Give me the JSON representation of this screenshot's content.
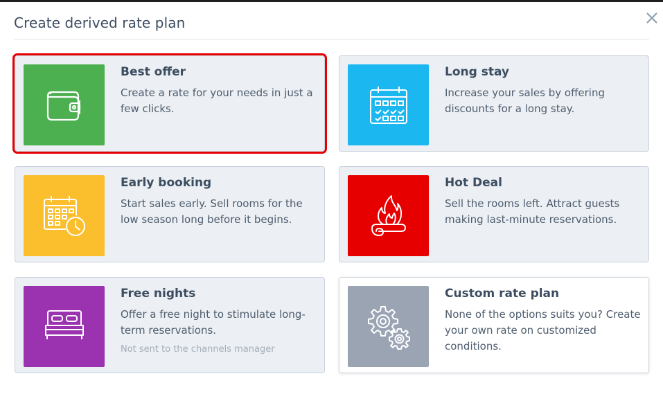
{
  "dialog": {
    "title": "Create derived rate plan"
  },
  "cards": [
    {
      "title": "Best offer",
      "desc": "Create a rate for your needs in just a few clicks.",
      "color": "#4caf50",
      "icon": "wallet-icon",
      "selected": true
    },
    {
      "title": "Long stay",
      "desc": "Increase your sales by offering discounts for a long stay.",
      "color": "#1ab7f0",
      "icon": "calendar-icon"
    },
    {
      "title": "Early booking",
      "desc": "Start sales early. Sell rooms for the low season long before it begins.",
      "color": "#fbbf2e",
      "icon": "calendar-clock-icon"
    },
    {
      "title": "Hot Deal",
      "desc": "Sell the rooms left. Attract guests making last-minute reservations.",
      "color": "#e60000",
      "icon": "flame-icon"
    },
    {
      "title": "Free nights",
      "desc": "Offer a free night to stimulate long-term reservations.",
      "note": "Not sent to the channels manager",
      "color": "#9b32b0",
      "icon": "bed-icon"
    },
    {
      "title": "Custom rate plan",
      "desc": "None of the options suits you? Create your own rate on customized conditions.",
      "color": "#9aa4b3",
      "icon": "gears-icon"
    }
  ]
}
